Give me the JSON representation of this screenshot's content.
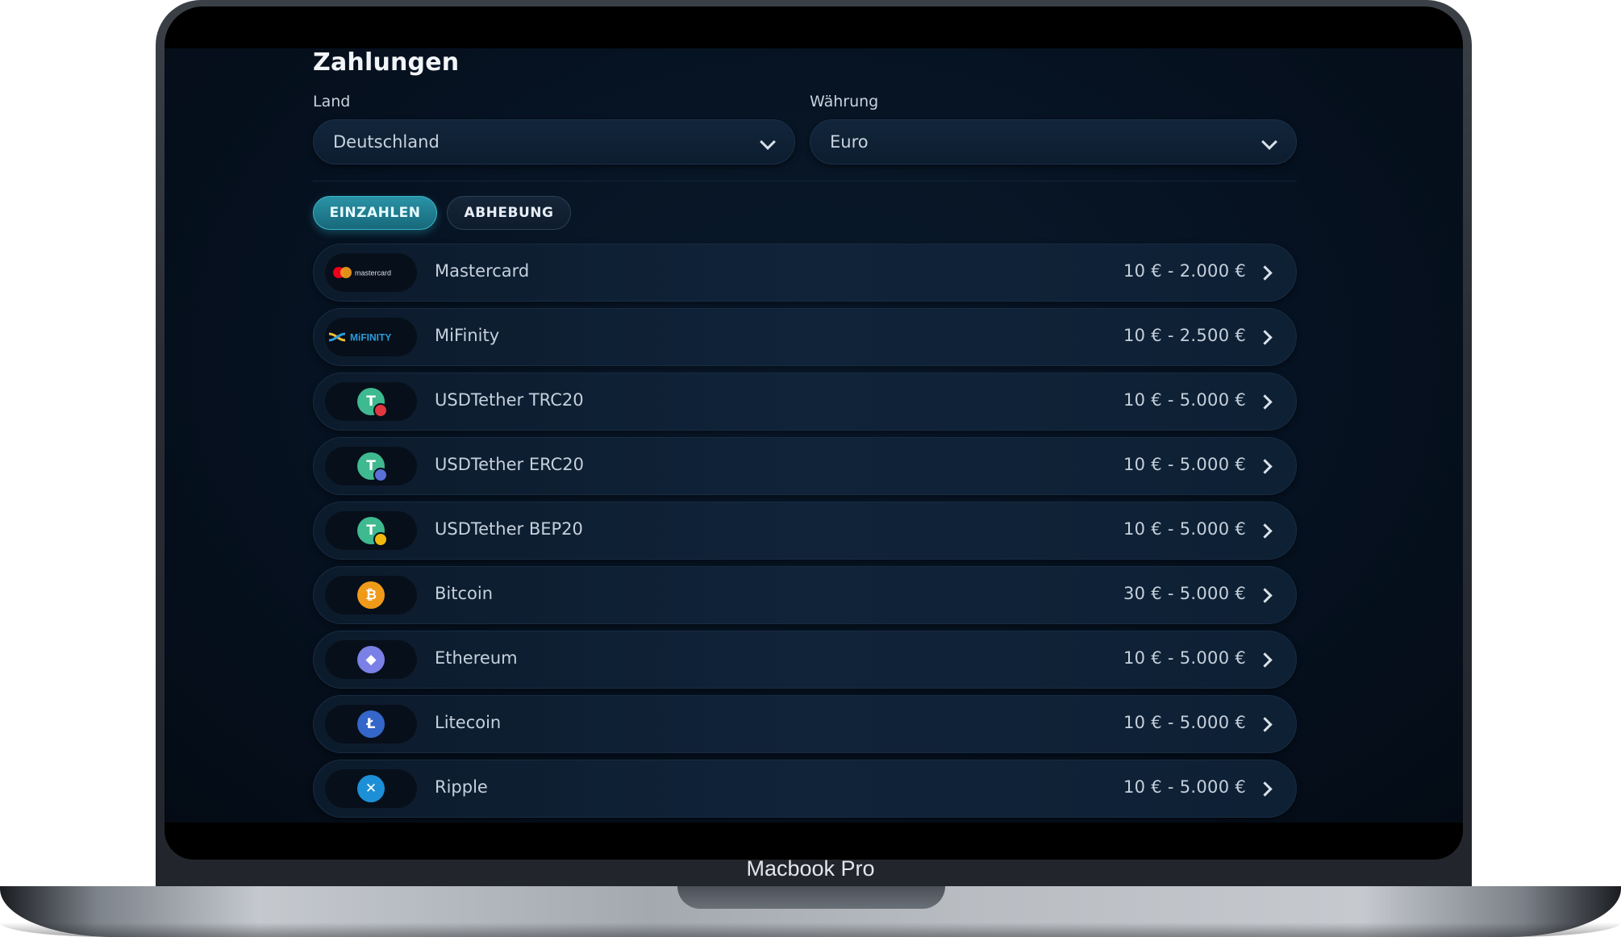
{
  "device": {
    "label": "Macbook Pro"
  },
  "page": {
    "title": "Zahlungen",
    "country": {
      "label": "Land",
      "value": "Deutschland"
    },
    "currency": {
      "label": "Währung",
      "value": "Euro"
    },
    "tabs": [
      {
        "label": "EINZAHLEN",
        "active": true
      },
      {
        "label": "ABHEBUNG",
        "active": false
      }
    ],
    "methods": [
      {
        "name": "Mastercard",
        "range": "10 € - 2.000 €",
        "logo_text": "mastercard",
        "icon": "mastercard-logo"
      },
      {
        "name": "MiFinity",
        "range": "10 € - 2.500 €",
        "logo_text": "MiFINITY",
        "icon": "mifinity-logo"
      },
      {
        "name": "USDTether TRC20",
        "range": "10 € - 5.000 €",
        "icon": "tether-icon",
        "glyph": "T",
        "color": "#3fb98f",
        "badge": "#e2373f"
      },
      {
        "name": "USDTether ERC20",
        "range": "10 € - 5.000 €",
        "icon": "tether-icon",
        "glyph": "T",
        "color": "#3fb98f",
        "badge": "#5a6fd8"
      },
      {
        "name": "USDTether BEP20",
        "range": "10 € - 5.000 €",
        "icon": "tether-icon",
        "glyph": "T",
        "color": "#3fb98f",
        "badge": "#f0b90b"
      },
      {
        "name": "Bitcoin",
        "range": "30 € - 5.000 €",
        "icon": "bitcoin-icon",
        "glyph": "₿",
        "color": "#f09a1a"
      },
      {
        "name": "Ethereum",
        "range": "10 € - 5.000 €",
        "icon": "ethereum-icon",
        "glyph": "◆",
        "color": "#7b80e6"
      },
      {
        "name": "Litecoin",
        "range": "10 € - 5.000 €",
        "icon": "litecoin-icon",
        "glyph": "Ł",
        "color": "#3566c9"
      },
      {
        "name": "Ripple",
        "range": "10 € - 5.000 €",
        "icon": "ripple-icon",
        "glyph": "✕",
        "color": "#1d8fd6"
      }
    ]
  }
}
